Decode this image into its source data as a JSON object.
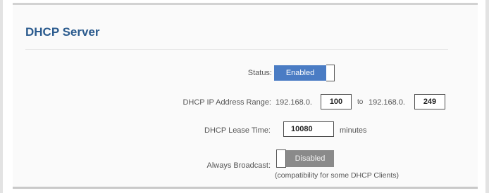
{
  "section": {
    "title": "DHCP Server"
  },
  "status": {
    "label": "Status:",
    "toggle_text": "Enabled",
    "enabled": true
  },
  "range": {
    "label": "DHCP IP Address Range:",
    "start_prefix": "192.168.0.",
    "start_value": "100",
    "to_text": "to",
    "end_prefix": "192.168.0.",
    "end_value": "249"
  },
  "lease": {
    "label": "DHCP Lease Time:",
    "value": "10080",
    "unit": "minutes"
  },
  "broadcast": {
    "label": "Always Broadcast:",
    "toggle_text": "Disabled",
    "enabled": false,
    "note": "(compatibility for some DHCP Clients)"
  },
  "colors": {
    "accent": "#4a7cc4",
    "title": "#2b5b8e",
    "disabled": "#8a8a8a"
  }
}
